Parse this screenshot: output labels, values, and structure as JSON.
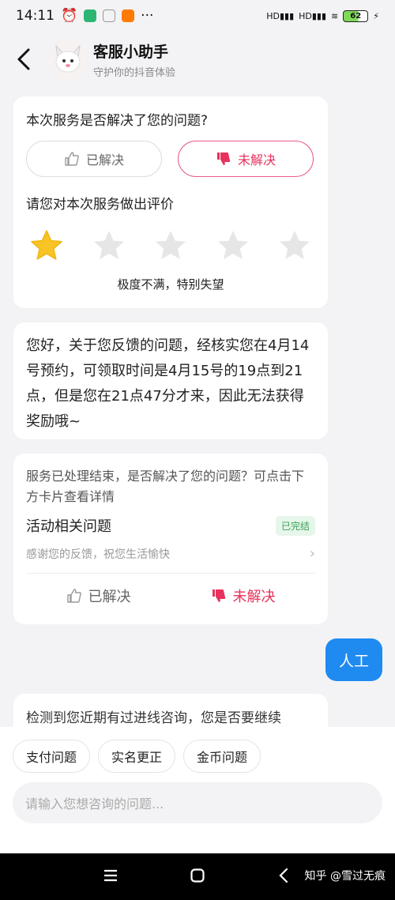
{
  "status_bar": {
    "time": "14:11",
    "battery": "62"
  },
  "header": {
    "title": "客服小助手",
    "subtitle": "守护你的抖音体验"
  },
  "feedback_card": {
    "question": "本次服务是否解决了您的问题?",
    "resolved_label": "已解决",
    "unresolved_label": "未解决",
    "rate_prompt": "请您对本次服务做出评价",
    "rating": 1,
    "rating_max": 5,
    "rating_text": "极度不满，特别失望"
  },
  "agent_message": "您好，关于您反馈的问题，经核实您在4月14号预约，可领取时间是4月15号的19点到21点，但是您在21点47分才来，因此无法获得奖励哦~",
  "case_card": {
    "intro": "服务已处理结束，是否解决了您的问题？可点击下方卡片查看详情",
    "issue_title": "活动相关问题",
    "status_badge": "已完结",
    "issue_desc": "感谢您的反馈，祝您生活愉快",
    "resolved_label": "已解决",
    "unresolved_label": "未解决"
  },
  "user_message": "人工",
  "partial_message": "检测到您近期有过进线咨询，您是否要继续",
  "quick_chips": [
    "支付问题",
    "实名更正",
    "金币问题"
  ],
  "input": {
    "placeholder": "请输入您想咨询的问题..."
  },
  "watermark": "知乎 @雪过无痕",
  "colors": {
    "accent_red": "#e8325d",
    "user_bubble": "#1f8bf0",
    "star_active": "#f7c325",
    "star_inactive": "#e6e6e6"
  }
}
